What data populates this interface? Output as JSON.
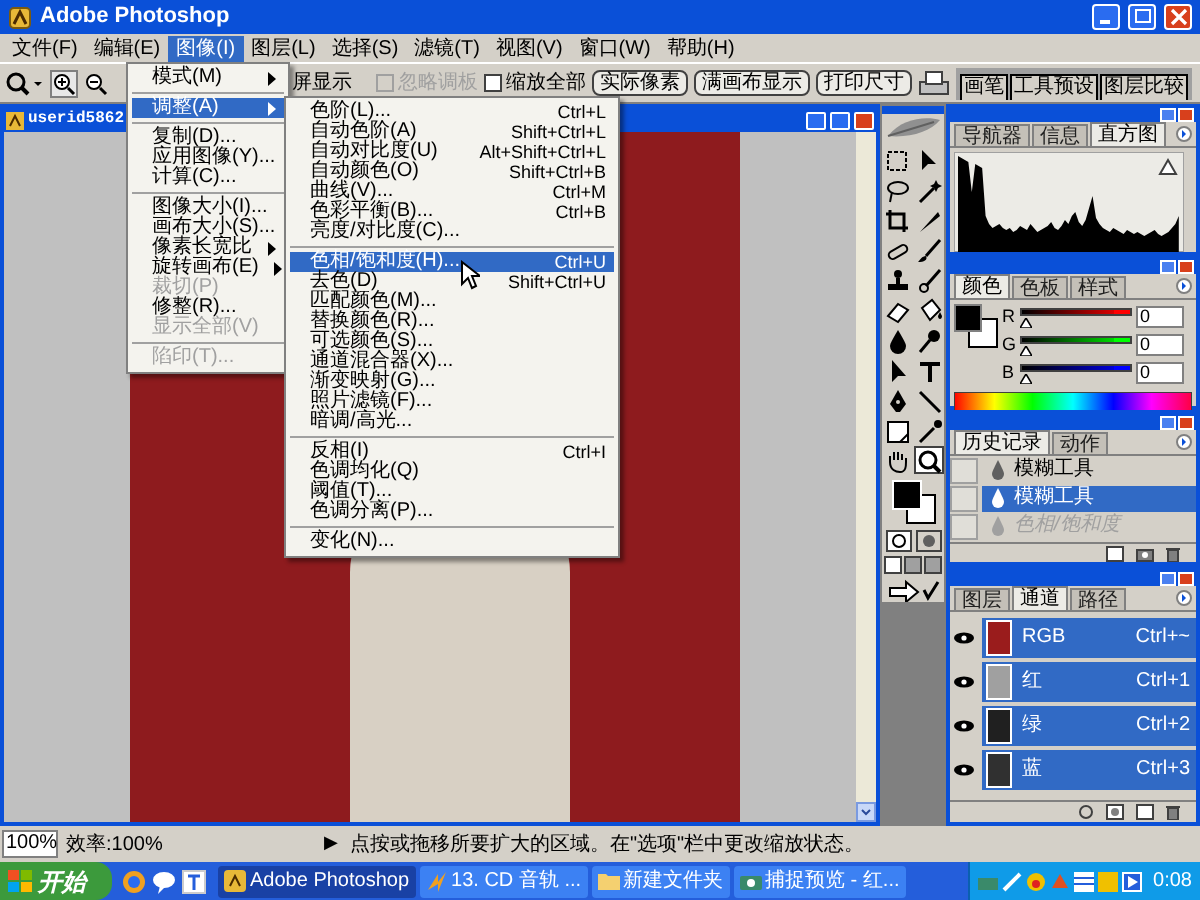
{
  "window": {
    "title": "Adobe Photoshop"
  },
  "menu_bar": [
    {
      "label": "文件(F)",
      "selected": false
    },
    {
      "label": "编辑(E)",
      "selected": false
    },
    {
      "label": "图像(I)",
      "selected": true
    },
    {
      "label": "图层(L)",
      "selected": false
    },
    {
      "label": "选择(S)",
      "selected": false
    },
    {
      "label": "滤镜(T)",
      "selected": false
    },
    {
      "label": "视图(V)",
      "selected": false
    },
    {
      "label": "窗口(W)",
      "selected": false
    },
    {
      "label": "帮助(H)",
      "selected": false
    }
  ],
  "options_bar": {
    "partial_label": "屏显示",
    "checkboxes": [
      {
        "label": "忽略调板",
        "checked": false,
        "disabled": true
      },
      {
        "label": "缩放全部",
        "checked": false,
        "disabled": false
      }
    ],
    "buttons": [
      "实际像素",
      "满画布显示",
      "打印尺寸"
    ],
    "palette_tabs": [
      "画笔",
      "工具预设",
      "图层比较"
    ]
  },
  "document": {
    "title": "userid5862"
  },
  "image_menu": {
    "items": [
      {
        "kind": "item",
        "label": "模式(M)",
        "submenu": true,
        "selected": false,
        "disabled": false
      },
      {
        "kind": "separator"
      },
      {
        "kind": "item",
        "label": "调整(A)",
        "submenu": true,
        "selected": true,
        "disabled": false
      },
      {
        "kind": "separator"
      },
      {
        "kind": "item",
        "label": "复制(D)...",
        "submenu": false,
        "selected": false,
        "disabled": false
      },
      {
        "kind": "item",
        "label": "应用图像(Y)...",
        "submenu": false,
        "selected": false,
        "disabled": false
      },
      {
        "kind": "item",
        "label": "计算(C)...",
        "submenu": false,
        "selected": false,
        "disabled": false
      },
      {
        "kind": "separator"
      },
      {
        "kind": "item",
        "label": "图像大小(I)...",
        "submenu": false,
        "selected": false,
        "disabled": false
      },
      {
        "kind": "item",
        "label": "画布大小(S)...",
        "submenu": false,
        "selected": false,
        "disabled": false
      },
      {
        "kind": "item",
        "label": "像素长宽比",
        "submenu": true,
        "selected": false,
        "disabled": false
      },
      {
        "kind": "item",
        "label": "旋转画布(E)",
        "submenu": true,
        "selected": false,
        "disabled": false
      },
      {
        "kind": "item",
        "label": "裁切(P)",
        "submenu": false,
        "selected": false,
        "disabled": true
      },
      {
        "kind": "item",
        "label": "修整(R)...",
        "submenu": false,
        "selected": false,
        "disabled": false
      },
      {
        "kind": "item",
        "label": "显示全部(V)",
        "submenu": false,
        "selected": false,
        "disabled": true
      },
      {
        "kind": "separator"
      },
      {
        "kind": "item",
        "label": "陷印(T)...",
        "submenu": false,
        "selected": false,
        "disabled": true
      }
    ]
  },
  "adjust_menu": {
    "items": [
      {
        "kind": "item",
        "label": "色阶(L)...",
        "shortcut": "Ctrl+L",
        "selected": false
      },
      {
        "kind": "item",
        "label": "自动色阶(A)",
        "shortcut": "Shift+Ctrl+L",
        "selected": false
      },
      {
        "kind": "item",
        "label": "自动对比度(U)",
        "shortcut": "Alt+Shift+Ctrl+L",
        "selected": false
      },
      {
        "kind": "item",
        "label": "自动颜色(O)",
        "shortcut": "Shift+Ctrl+B",
        "selected": false
      },
      {
        "kind": "item",
        "label": "曲线(V)...",
        "shortcut": "Ctrl+M",
        "selected": false
      },
      {
        "kind": "item",
        "label": "色彩平衡(B)...",
        "shortcut": "Ctrl+B",
        "selected": false
      },
      {
        "kind": "item",
        "label": "亮度/对比度(C)...",
        "selected": false
      },
      {
        "kind": "separator"
      },
      {
        "kind": "item",
        "label": "色相/饱和度(H)...",
        "shortcut": "Ctrl+U",
        "selected": true
      },
      {
        "kind": "item",
        "label": "去色(D)",
        "shortcut": "Shift+Ctrl+U",
        "selected": false
      },
      {
        "kind": "item",
        "label": "匹配颜色(M)...",
        "selected": false
      },
      {
        "kind": "item",
        "label": "替换颜色(R)...",
        "selected": false
      },
      {
        "kind": "item",
        "label": "可选颜色(S)...",
        "selected": false
      },
      {
        "kind": "item",
        "label": "通道混合器(X)...",
        "selected": false
      },
      {
        "kind": "item",
        "label": "渐变映射(G)...",
        "selected": false
      },
      {
        "kind": "item",
        "label": "照片滤镜(F)...",
        "selected": false
      },
      {
        "kind": "item",
        "label": "暗调/高光...",
        "selected": false
      },
      {
        "kind": "separator"
      },
      {
        "kind": "item",
        "label": "反相(I)",
        "shortcut": "Ctrl+I",
        "selected": false
      },
      {
        "kind": "item",
        "label": "色调均化(Q)",
        "selected": false
      },
      {
        "kind": "item",
        "label": "阈值(T)...",
        "selected": false
      },
      {
        "kind": "item",
        "label": "色调分离(P)...",
        "selected": false
      },
      {
        "kind": "separator"
      },
      {
        "kind": "item",
        "label": "变化(N)...",
        "selected": false
      }
    ]
  },
  "navigator_panel": {
    "tabs": [
      {
        "label": "导航器",
        "selected": false
      },
      {
        "label": "信息",
        "selected": false
      },
      {
        "label": "直方图",
        "selected": true
      }
    ]
  },
  "color_panel": {
    "tabs": [
      {
        "label": "颜色",
        "selected": true
      },
      {
        "label": "色板",
        "selected": false
      },
      {
        "label": "样式",
        "selected": false
      }
    ],
    "sliders": [
      {
        "name": "R",
        "color": "#ff0000",
        "level": 0,
        "reading": "0"
      },
      {
        "name": "G",
        "color": "#00ff00",
        "level": 0,
        "reading": "0"
      },
      {
        "name": "B",
        "color": "#0000ff",
        "level": 0,
        "reading": "0"
      }
    ]
  },
  "history_panel": {
    "tabs": [
      {
        "label": "历史记录",
        "selected": true
      },
      {
        "label": "动作",
        "selected": false
      }
    ],
    "items": [
      {
        "label": "模糊工具",
        "selected": false,
        "disabled": false,
        "snapshot": false
      },
      {
        "label": "模糊工具",
        "selected": true,
        "disabled": false,
        "snapshot": false
      },
      {
        "label": "色相/饱和度",
        "selected": false,
        "disabled": true,
        "snapshot": false
      }
    ]
  },
  "channels_panel": {
    "tabs": [
      {
        "label": "图层",
        "selected": false
      },
      {
        "label": "通道",
        "selected": true
      },
      {
        "label": "路径",
        "selected": false
      }
    ],
    "channels": [
      {
        "name": "RGB",
        "shortcut": "Ctrl+~",
        "selected": true,
        "visible": true,
        "color": "#9a1c1c"
      },
      {
        "name": "红",
        "shortcut": "Ctrl+1",
        "selected": true,
        "visible": true,
        "color": "#a0a0a0"
      },
      {
        "name": "绿",
        "shortcut": "Ctrl+2",
        "selected": true,
        "visible": true,
        "color": "#202020"
      },
      {
        "name": "蓝",
        "shortcut": "Ctrl+3",
        "selected": true,
        "visible": true,
        "color": "#303030"
      }
    ]
  },
  "status_bar": {
    "zoom": "100%",
    "efficiency": "效率:100%",
    "arrow": "▶",
    "message": "点按或拖移所要扩大的区域。在\"选项\"栏中更改缩放状态。"
  },
  "taskbar": {
    "start": "开始",
    "tasks": [
      {
        "label": "Adobe Photoshop",
        "selected": true
      },
      {
        "label": "13. CD 音轨 ...",
        "selected": false
      },
      {
        "label": "新建文件夹",
        "selected": false
      },
      {
        "label": "捕捉预览 - 红...",
        "selected": false
      }
    ],
    "clock": "0:08"
  }
}
